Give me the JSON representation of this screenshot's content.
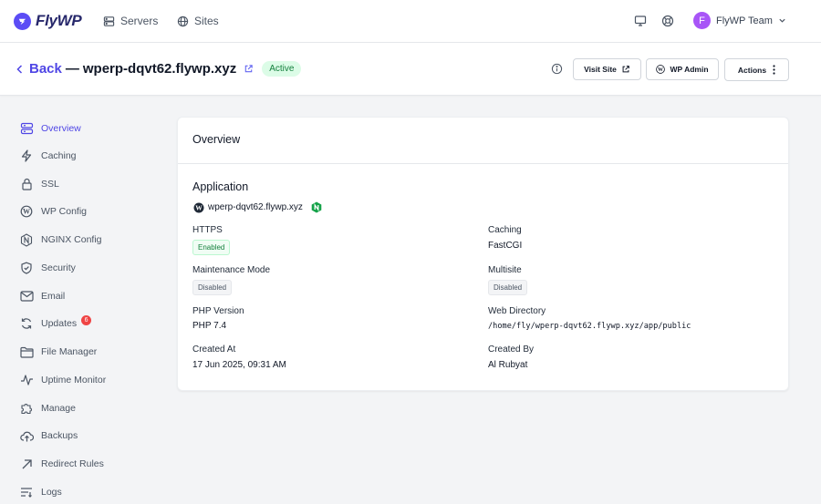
{
  "brand": {
    "name": "FlyWP",
    "accent": "#5b4cf5"
  },
  "topnav": {
    "items": [
      {
        "label": "Servers",
        "icon": "server-icon"
      },
      {
        "label": "Sites",
        "icon": "globe-icon"
      }
    ],
    "user": {
      "initial": "F",
      "team": "FlyWP Team"
    }
  },
  "header": {
    "back_label": "Back",
    "separator": "—",
    "site_name": "wperp-dqvt62.flywp.xyz",
    "status": "Active",
    "buttons": {
      "visit": "Visit Site",
      "wp_admin": "WP Admin",
      "actions": "Actions"
    }
  },
  "sidebar": {
    "items": [
      {
        "label": "Overview",
        "icon": "server-stack-icon",
        "active": true
      },
      {
        "label": "Caching",
        "icon": "bolt-icon"
      },
      {
        "label": "SSL",
        "icon": "lock-icon"
      },
      {
        "label": "WP Config",
        "icon": "wordpress-icon"
      },
      {
        "label": "NGINX Config",
        "icon": "nginx-icon"
      },
      {
        "label": "Security",
        "icon": "shield-icon"
      },
      {
        "label": "Email",
        "icon": "envelope-icon"
      },
      {
        "label": "Updates",
        "icon": "refresh-icon",
        "badge": "6"
      },
      {
        "label": "File Manager",
        "icon": "folder-icon"
      },
      {
        "label": "Uptime Monitor",
        "icon": "pulse-icon"
      },
      {
        "label": "Manage",
        "icon": "puzzle-icon"
      },
      {
        "label": "Backups",
        "icon": "cloud-upload-icon"
      },
      {
        "label": "Redirect Rules",
        "icon": "arrow-up-right-icon"
      },
      {
        "label": "Logs",
        "icon": "list-filter-icon"
      }
    ]
  },
  "overview": {
    "title": "Overview",
    "application": {
      "heading": "Application",
      "domain": "wperp-dqvt62.flywp.xyz"
    },
    "fields": {
      "https": {
        "label": "HTTPS",
        "value": "Enabled"
      },
      "caching": {
        "label": "Caching",
        "value": "FastCGI"
      },
      "maintenance": {
        "label": "Maintenance Mode",
        "value": "Disabled"
      },
      "multisite": {
        "label": "Multisite",
        "value": "Disabled"
      },
      "php": {
        "label": "PHP Version",
        "value": "PHP 7.4"
      },
      "webdir": {
        "label": "Web Directory",
        "value": "/home/fly/wperp-dqvt62.flywp.xyz/app/public"
      },
      "created_at": {
        "label": "Created At",
        "value": "17 Jun 2025, 09:31 AM"
      },
      "created_by": {
        "label": "Created By",
        "value": "Al Rubyat"
      }
    }
  }
}
